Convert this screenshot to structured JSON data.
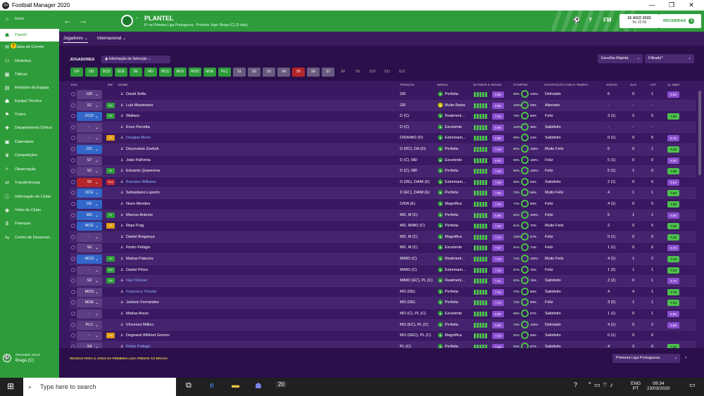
{
  "window": {
    "title": "Football Manager 2020",
    "controls": [
      "—",
      "❐",
      "✕"
    ]
  },
  "sidebar": {
    "items": [
      {
        "icon": "home-icon",
        "glyph": "⌂",
        "label": "Início"
      },
      {
        "icon": "squad-icon",
        "glyph": "☗",
        "label": "Plantel",
        "active": true
      },
      {
        "icon": "mail-icon",
        "glyph": "✉",
        "label": "Caixa de Correio",
        "badge": "3"
      },
      {
        "icon": "dynamics-icon",
        "glyph": "⚇",
        "label": "Dinâmica"
      },
      {
        "icon": "tactics-icon",
        "glyph": "▦",
        "label": "Táticas"
      },
      {
        "icon": "report-icon",
        "glyph": "▤",
        "label": "Relatório da Equipa"
      },
      {
        "icon": "staff-icon",
        "glyph": "☗",
        "label": "Equipa Técnica"
      },
      {
        "icon": "training-icon",
        "glyph": "⚑",
        "label": "Treino"
      },
      {
        "icon": "medical-icon",
        "glyph": "✚",
        "label": "Departamento Clínico"
      },
      {
        "icon": "calendar-icon",
        "glyph": "▣",
        "label": "Calendário"
      },
      {
        "icon": "trophy-icon",
        "glyph": "♛",
        "label": "Competições"
      },
      {
        "icon": "scouting-icon",
        "glyph": "⌕",
        "label": "Observação"
      },
      {
        "icon": "transfers-icon",
        "glyph": "⇄",
        "label": "Transferências"
      },
      {
        "icon": "club-info-icon",
        "glyph": "ⓘ",
        "label": "Informação do Clube"
      },
      {
        "icon": "club-vision-icon",
        "glyph": "◉",
        "label": "Visão do Clube"
      },
      {
        "icon": "finances-icon",
        "glyph": "$",
        "label": "Finanças"
      },
      {
        "icon": "development-icon",
        "glyph": "⇆",
        "label": "Centro de Desenvol..."
      }
    ],
    "next_match": {
      "label": "PRÓXIMO JOGO",
      "value": "Braga (C)"
    }
  },
  "header": {
    "title": "PLANTEL",
    "subtitle": "8º na Primeira Liga Portuguesa - Próximo Jogo: Braga (C) (5 dias)",
    "fm": "FM",
    "date": "16 AGO 2022",
    "time": "Ter 22:00",
    "inbox": "RECEBIDAS",
    "inbox_count": "1"
  },
  "tabs": [
    {
      "label": "Jogadores ⌄"
    },
    {
      "label": "Internacional ⌄"
    }
  ],
  "toolbar": {
    "jogadores": "JOGADORES",
    "sel_info": "Informação de Selecção",
    "quick": "Escolha Rápida",
    "filtered": "Filtrado*"
  },
  "filters": [
    {
      "label": "GR",
      "style": ""
    },
    {
      "label": "DD",
      "style": ""
    },
    {
      "label": "DCD",
      "style": ""
    },
    {
      "label": "DCE",
      "style": ""
    },
    {
      "label": "DE",
      "style": ""
    },
    {
      "label": "MD",
      "style": ""
    },
    {
      "label": "MCD",
      "style": ""
    },
    {
      "label": "MCE",
      "style": ""
    },
    {
      "label": "MOD",
      "style": ""
    },
    {
      "label": "MOE",
      "style": ""
    },
    {
      "label": "PLC",
      "style": ""
    },
    {
      "label": "S1",
      "style": "grey"
    },
    {
      "label": "S2",
      "style": "grey"
    },
    {
      "label": "S3",
      "style": "grey"
    },
    {
      "label": "S4",
      "style": "grey"
    },
    {
      "label": "S5",
      "style": "red"
    },
    {
      "label": "S6",
      "style": "grey"
    },
    {
      "label": "S7",
      "style": "grey"
    },
    {
      "label": "S8",
      "style": "dark"
    },
    {
      "label": "S9",
      "style": "dark"
    },
    {
      "label": "S10",
      "style": "dark"
    },
    {
      "label": "S11",
      "style": "dark"
    },
    {
      "label": "S12",
      "style": "dark"
    }
  ],
  "columns": {
    "esc": "ESC",
    "inf": "INF",
    "nome": "NOME",
    "posicao": "POSIÇÃO",
    "moral": "MORAL",
    "ultimos": "ÚLTIMOS 5 JOGOS",
    "cond": "CON/PRE",
    "satisfacao": "SATISFAÇÃO COM O TEMPO...",
    "jogos": "JOGOS",
    "gls": "GLS",
    "ast": "AST",
    "clmed": "CL MED"
  },
  "players": [
    {
      "esc": "GR",
      "pc": "",
      "inf": "",
      "ic": "",
      "name": "David Sofia",
      "pos": "GR",
      "moral": "Perfeita",
      "mc": "",
      "ljv": "6.90",
      "cond": "99%",
      "pre": "100%",
      "sat": "Deliciado",
      "jogos": "6",
      "gls": "0",
      "ast": "1",
      "med": "6.90",
      "mp": "p"
    },
    {
      "esc": "S1",
      "pc": "",
      "inf": "Dsi",
      "ic": "",
      "name": "Luís Maximiano",
      "pos": "GR",
      "moral": "Muito Baixa",
      "mc": "y",
      "ljv": "6.86",
      "cond": "100%",
      "pre": "28%",
      "sat": "Alienado",
      "jogos": "-",
      "gls": "-",
      "ast": "-",
      "med": "",
      "mp": ""
    },
    {
      "esc": "DCD",
      "pc": "blue",
      "inf": "Pd",
      "ic": "",
      "name": "Wallace",
      "pos": "D (C)",
      "moral": "Realment...",
      "mc": "",
      "ljv": "7.40",
      "cond": "78%",
      "pre": "60%",
      "sat": "Feliz",
      "jogos": "3 (1)",
      "gls": "2",
      "ast": "0",
      "med": "7.63",
      "mp": ""
    },
    {
      "esc": "-",
      "pc": "",
      "inf": "",
      "ic": "",
      "name": "Enzo Perrotta",
      "pos": "D (C)",
      "moral": "Excelente",
      "mc": "",
      "ljv": "6.86",
      "cond": "100%",
      "pre": "38%",
      "sat": "Satisfeito",
      "jogos": "-",
      "gls": "-",
      "ast": "-",
      "med": "",
      "mp": ""
    },
    {
      "esc": "-",
      "pc": "",
      "inf": "TP",
      "ic": "y",
      "name": "Douglas Borel",
      "pos": "D/DA/MO (D)",
      "moral": "Extremam...",
      "mc": "",
      "ljv": "6.86",
      "cond": "98%",
      "pre": "43%",
      "sat": "Satisfeito",
      "jogos": "0 (1)",
      "gls": "0",
      "ast": "0",
      "med": "6.70",
      "mp": "p"
    },
    {
      "esc": "DD",
      "pc": "blue",
      "inf": "",
      "ic": "",
      "name": "Deyovaisio Zeefuik",
      "pos": "D (DC), DA (D)",
      "moral": "Perfeita",
      "mc": "",
      "ljv": "7.20",
      "cond": "80%",
      "pre": "100%",
      "sat": "Muito Feliz",
      "jogos": "6",
      "gls": "0",
      "ast": "1",
      "med": "7.23",
      "mp": ""
    },
    {
      "esc": "S7",
      "pc": "",
      "inf": "",
      "ic": "",
      "name": "João Palhinha",
      "pos": "D (C), MD",
      "moral": "Excelente",
      "mc": "",
      "ljv": "6.92",
      "cond": "99%",
      "pre": "100%",
      "sat": "Feliz",
      "jogos": "5 (1)",
      "gls": "0",
      "ast": "0",
      "med": "6.92",
      "mp": "p"
    },
    {
      "esc": "S2",
      "pc": "",
      "inf": "Rl",
      "ic": "",
      "name": "Eduardo Quaresma",
      "pos": "D (C), MD",
      "moral": "Perfeita",
      "mc": "",
      "ljv": "7.06",
      "cond": "90%",
      "pre": "100%",
      "sat": "Feliz",
      "jogos": "5 (1)",
      "gls": "1",
      "ast": "0",
      "med": "7.05",
      "mp": ""
    },
    {
      "esc": "S5",
      "pc": "red",
      "inf": "Sus",
      "ic": "r",
      "name": "Brandon Williams",
      "pos": "D (DE), DA/M (E)",
      "moral": "Extremam...",
      "mc": "",
      "ljv": "7.08",
      "cond": "99%",
      "pre": "63%",
      "sat": "Satisfeito",
      "jogos": "2 (1)",
      "gls": "0",
      "ast": "0",
      "med": "6.93",
      "mp": "p"
    },
    {
      "esc": "DCE",
      "pc": "blue",
      "inf": "",
      "ic": "",
      "name": "Sebastiano Luperto",
      "pos": "D (EC), DA/M (E)",
      "moral": "Perfeita",
      "mc": "",
      "ljv": "7.56",
      "cond": "75%",
      "pre": "68%",
      "sat": "Muito Feliz",
      "jogos": "4",
      "gls": "1",
      "ast": "1",
      "med": "7.63",
      "mp": ""
    },
    {
      "esc": "DE",
      "pc": "blue",
      "inf": "",
      "ic": "",
      "name": "Nuno Mendes",
      "pos": "D/DA (E)",
      "moral": "Magnífica",
      "mc": "",
      "ljv": "7.00",
      "cond": "74%",
      "pre": "89%",
      "sat": "Feliz",
      "jogos": "4 (1)",
      "gls": "0",
      "ast": "0",
      "med": "7.00",
      "mp": ""
    },
    {
      "esc": "MD",
      "pc": "blue",
      "inf": "Rl",
      "ic": "",
      "name": "Marcos Antonio",
      "pos": "MD, M (C)",
      "moral": "Perfeita",
      "mc": "",
      "ljv": "6.96",
      "cond": "93%",
      "pre": "100%",
      "sat": "Feliz",
      "jogos": "5",
      "gls": "1",
      "ast": "1",
      "med": "6.96",
      "mp": "p"
    },
    {
      "esc": "MCE",
      "pc": "blue",
      "inf": "TP",
      "ic": "y",
      "name": "Riqui Puig",
      "pos": "MD, M/MO (C)",
      "moral": "Perfeita",
      "mc": "",
      "ljv": "7.30",
      "cond": "81%",
      "pre": "70%",
      "sat": "Muito Feliz",
      "jogos": "2",
      "gls": "0",
      "ast": "0",
      "med": "7.45",
      "mp": ""
    },
    {
      "esc": "-",
      "pc": "",
      "inf": "",
      "ic": "",
      "name": "Daniel Bragança",
      "pos": "MD, M (C)",
      "moral": "Magnífica",
      "mc": "",
      "ljv": "7.22",
      "cond": "100%",
      "pre": "57%",
      "sat": "Feliz",
      "jogos": "0 (1)",
      "gls": "0",
      "ast": "0",
      "med": "7.10",
      "mp": ""
    },
    {
      "esc": "S6",
      "pc": "",
      "inf": "",
      "ic": "",
      "name": "Pedro Pelágio",
      "pos": "MD, M (C)",
      "moral": "Excelente",
      "mc": "",
      "ljv": "7.07",
      "cond": "91%",
      "pre": "74%",
      "sat": "Feliz",
      "jogos": "1 (1)",
      "gls": "0",
      "ast": "0",
      "med": "6.70",
      "mp": "p"
    },
    {
      "esc": "MCD",
      "pc": "blue",
      "inf": "Pd",
      "ic": "",
      "name": "Matías Palacios",
      "pos": "M/MO (C)",
      "moral": "Realment...",
      "mc": "",
      "ljv": "7.43",
      "cond": "74%",
      "pre": "100%",
      "sat": "Muito Feliz",
      "jogos": "4 (1)",
      "gls": "1",
      "ast": "2",
      "med": "7.43",
      "mp": ""
    },
    {
      "esc": "-",
      "pc": "",
      "inf": "SIS",
      "ic": "",
      "name": "Daniel Pérez",
      "pos": "M/MO (C)",
      "moral": "Extremam...",
      "mc": "",
      "ljv": "7.34",
      "cond": "97%",
      "pre": "70%",
      "sat": "Feliz",
      "jogos": "1 (2)",
      "gls": "1",
      "ast": "1",
      "med": "7.23",
      "mp": ""
    },
    {
      "esc": "S3",
      "pc": "",
      "inf": "Dsi",
      "ic": "",
      "name": "Naci Ünüvar",
      "pos": "M/MO (EC), PL (C)",
      "moral": "Realment...",
      "mc": "",
      "ljv": "7.21",
      "cond": "93%",
      "pre": "76%",
      "sat": "Satisfeito",
      "jogos": "2 (2)",
      "gls": "0",
      "ast": "1",
      "med": "6.73",
      "mp": "p"
    },
    {
      "esc": "MOD",
      "pc": "",
      "inf": "",
      "ic": "",
      "name": "Francisco Trincão",
      "pos": "MO (DE)",
      "moral": "Perfeita",
      "mc": "",
      "ljv": "7.64",
      "cond": "70%",
      "pre": "88%",
      "sat": "Satisfeito",
      "jogos": "4",
      "gls": "4",
      "ast": "1",
      "med": "7.73",
      "mp": ""
    },
    {
      "esc": "MOE",
      "pc": "",
      "inf": "",
      "ic": "",
      "name": "Joelson Fernandes",
      "pos": "MO (DE)",
      "moral": "Perfeita",
      "mc": "",
      "ljv": "7.24",
      "cond": "73%",
      "pre": "93%",
      "sat": "Feliz",
      "jogos": "3 (2)",
      "gls": "1",
      "ast": "1",
      "med": "7.24",
      "mp": ""
    },
    {
      "esc": "-",
      "pc": "",
      "inf": "",
      "ic": "",
      "name": "Matías Arezo",
      "pos": "MO (C), PL (C)",
      "moral": "Excelente",
      "mc": "",
      "ljv": "6.80",
      "cond": "98%",
      "pre": "57%",
      "sat": "Satisfeito",
      "jogos": "1 (1)",
      "gls": "0",
      "ast": "1",
      "med": "6.80",
      "mp": "p"
    },
    {
      "esc": "PLC",
      "pc": "",
      "inf": "",
      "ic": "",
      "name": "Vincenzo Millico",
      "pos": "MO (EC), PL (C)",
      "moral": "Perfeita",
      "mc": "",
      "ljv": "6.96",
      "cond": "78%",
      "pre": "100%",
      "sat": "Deliciado",
      "jogos": "4 (1)",
      "gls": "0",
      "ast": "2",
      "med": "6.96",
      "mp": "p"
    },
    {
      "esc": "-",
      "pc": "",
      "inf": "Les",
      "ic": "y",
      "name": "Degnand Wilfried Gnonto",
      "pos": "MO (DEC), PL (C)",
      "moral": "Magnífica",
      "mc": "",
      "ljv": "7.20",
      "cond": "92%",
      "pre": "58%",
      "sat": "Satisfeito",
      "jogos": "0 (1)",
      "gls": "0",
      "ast": "0",
      "med": "",
      "mp": ""
    },
    {
      "esc": "S4",
      "pc": "",
      "inf": "",
      "ic": "",
      "name": "Pietro Pellegri",
      "pos": "PL (C)",
      "moral": "Perfeita",
      "mc": "",
      "ljv": "7.20",
      "cond": "93%",
      "pre": "87%",
      "sat": "Satisfeito",
      "jogos": "4",
      "gls": "3",
      "ast": "0",
      "med": "7.22",
      "mp": ""
    }
  ],
  "footer": {
    "rules": "REGRAS PARA O JOGO DA PRIMEIRA LIGA FRENTE AO BRAGA",
    "league": "Primeira Liga Portuguesa"
  },
  "taskbar": {
    "search": "Type here to search",
    "lang1": "ENG",
    "lang2": "PT",
    "time": "09:34",
    "date": "23/03/2020"
  }
}
